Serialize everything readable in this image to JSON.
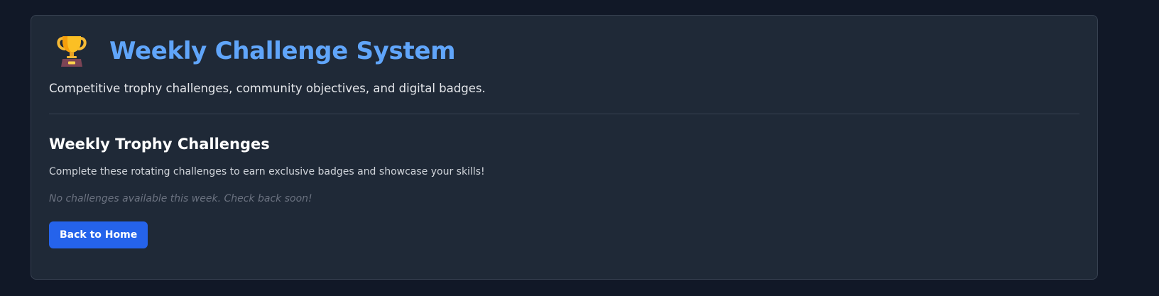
{
  "header": {
    "icon": "trophy-icon",
    "title": "Weekly Challenge System",
    "subtitle": "Competitive trophy challenges, community objectives, and digital badges."
  },
  "section": {
    "title": "Weekly Trophy Challenges",
    "description": "Complete these rotating challenges to earn exclusive badges and showcase your skills!",
    "empty_message": "No challenges available this week. Check back soon!"
  },
  "actions": {
    "back_label": "Back to Home"
  },
  "colors": {
    "page_background": "#111827",
    "card_background": "#1f2937",
    "title_accent": "#60a5fa",
    "button": "#2563eb"
  }
}
